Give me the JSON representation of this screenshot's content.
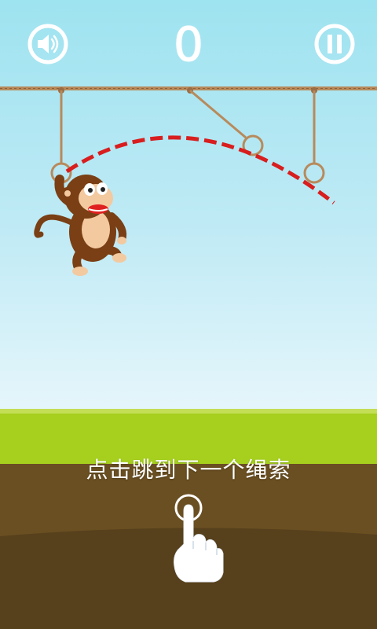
{
  "hud": {
    "score": "0",
    "sound_icon": "speaker-icon",
    "pause_icon": "pause-icon"
  },
  "hint": {
    "text": "点击跳到下一个绳索",
    "icon": "tap-hand-icon"
  },
  "colors": {
    "sky_top": "#9ee3f0",
    "grass": "#a6cf1e",
    "soil": "#6a4f22",
    "soil_dark": "#57401c",
    "rope": "#b88a5c",
    "trajectory": "#d81e1e",
    "monkey": "#7a3f14"
  },
  "scene": {
    "character": "monkey",
    "ropes_visible": 3
  }
}
